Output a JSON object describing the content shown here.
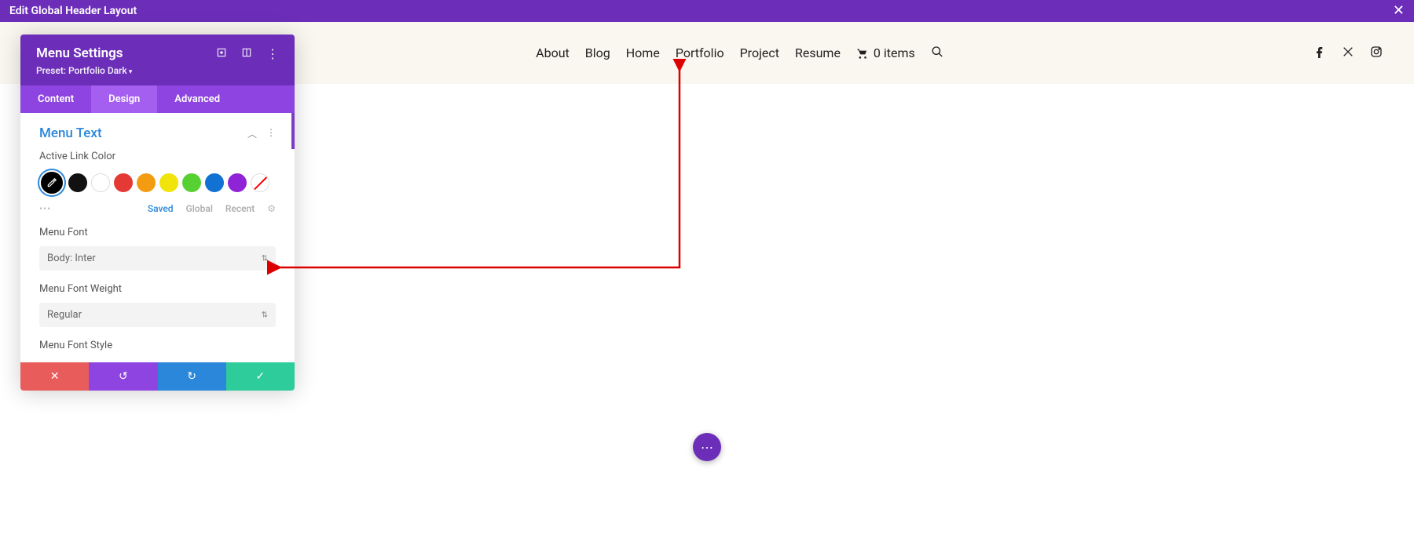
{
  "topbar": {
    "title": "Edit Global Header Layout"
  },
  "nav": {
    "items": [
      "About",
      "Blog",
      "Home",
      "Portfolio",
      "Project",
      "Resume"
    ],
    "cart_label": "0 items"
  },
  "panel": {
    "title": "Menu Settings",
    "preset": "Preset: Portfolio Dark",
    "tabs": {
      "content": "Content",
      "design": "Design",
      "advanced": "Advanced"
    },
    "section": "Menu Text",
    "fields": {
      "active_link_color": "Active Link Color",
      "menu_font": "Menu Font",
      "menu_font_weight": "Menu Font Weight",
      "menu_font_style": "Menu Font Style"
    },
    "values": {
      "menu_font": "Body: Inter",
      "menu_font_weight": "Regular"
    },
    "color_tabs": {
      "saved": "Saved",
      "global": "Global",
      "recent": "Recent"
    },
    "swatch_colors": [
      "#000000",
      "#111111",
      "#ffffff",
      "#e53935",
      "#f39c12",
      "#f1e40a",
      "#57d131",
      "#1172d3",
      "#8e24d6"
    ]
  },
  "colors": {
    "brand": "#6c2eb9"
  }
}
